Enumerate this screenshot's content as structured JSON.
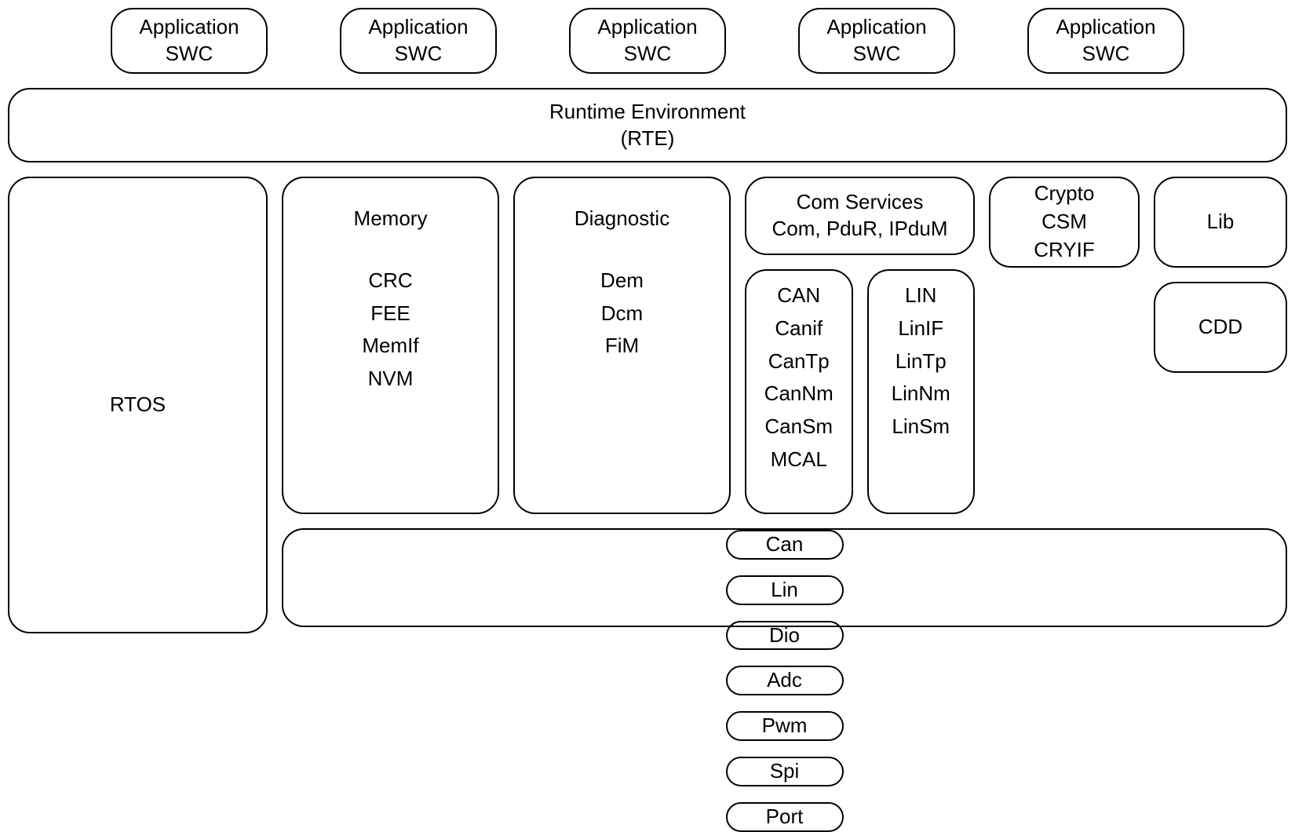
{
  "app": {
    "swc_line1": "Application",
    "swc_line2": "SWC"
  },
  "rte": {
    "line1": "Runtime Environment",
    "line2": "(RTE)"
  },
  "rtos": {
    "label": "RTOS"
  },
  "memory": {
    "title": "Memory",
    "items": [
      "CRC",
      "FEE",
      "MemIf",
      "NVM"
    ]
  },
  "diagnostic": {
    "title": "Diagnostic",
    "items": [
      "Dem",
      "Dcm",
      "FiM"
    ]
  },
  "com_services": {
    "line1": "Com Services",
    "line2": "Com, PduR, IPduM"
  },
  "can_stack": {
    "items": [
      "CAN",
      "Canif",
      "CanTp",
      "CanNm",
      "CanSm",
      "MCAL"
    ]
  },
  "lin_stack": {
    "items": [
      "LIN",
      "LinIF",
      "LinTp",
      "LinNm",
      "LinSm"
    ]
  },
  "crypto": {
    "items": [
      "Crypto",
      "CSM",
      "CRYIF"
    ]
  },
  "lib": {
    "label": "Lib"
  },
  "cdd": {
    "label": "CDD"
  },
  "mcal": {
    "items": [
      "Can",
      "Lin",
      "Dio",
      "Adc",
      "Pwm",
      "Spi",
      "Port"
    ]
  }
}
